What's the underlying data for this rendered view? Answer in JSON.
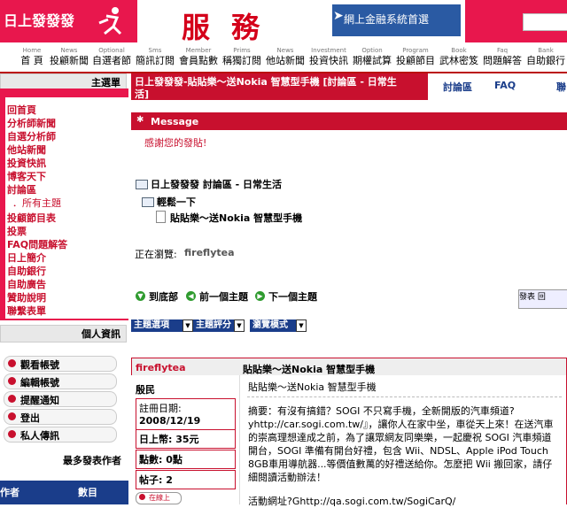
{
  "header": {
    "logo_text": "日上發發發",
    "service_text": "服務",
    "finance_link": "網上金融系統首選"
  },
  "nav": [
    {
      "en": "Home",
      "zh": "首 頁"
    },
    {
      "en": "News",
      "zh": "投顧新聞"
    },
    {
      "en": "Optional",
      "zh": "自選者節"
    },
    {
      "en": "Sms",
      "zh": "簡訊訂閱"
    },
    {
      "en": "Member",
      "zh": "會員點數"
    },
    {
      "en": "Prims",
      "zh": "稱獨訂閱"
    },
    {
      "en": "News",
      "zh": "他站新聞"
    },
    {
      "en": "Investment",
      "zh": "投資快訊"
    },
    {
      "en": "Option",
      "zh": "期權試算"
    },
    {
      "en": "Program",
      "zh": "投顧節目"
    },
    {
      "en": "Book",
      "zh": "武林密笈"
    },
    {
      "en": "Faq",
      "zh": "問題解答"
    },
    {
      "en": "Bank",
      "zh": "自助銀行"
    }
  ],
  "sidebar": {
    "main_menu_title": "主選單",
    "menu_items": [
      "回首頁",
      "分析師新聞",
      "自選分析師",
      "他站新聞",
      "投資快訊",
      "博客天下",
      "討論區",
      "．所有主題",
      "投顧節目表",
      "投票",
      "FAQ問題解答",
      "日上簡介",
      "自助銀行",
      "自助廣告",
      "贊助說明",
      "聯繫表單"
    ],
    "user_info_title": "個人資訊",
    "user_buttons": [
      "觀看帳號",
      "編輯帳號",
      "提醒通知",
      "登出",
      "私人傳訊"
    ],
    "top_posters_title": "最多發表作者",
    "table_headers": [
      "作者",
      "數目"
    ]
  },
  "main": {
    "topic_title": "日上發發發-貼貼樂～送Nokia 智慧型手機 [討論區 - 日常生活]",
    "toolbar": [
      "討論區",
      "FAQ",
      "聯"
    ],
    "message_title": "Message",
    "thanks_text": "感謝您的發貼!",
    "breadcrumb_forum": "日上發發發 討論區 - 日常生活",
    "breadcrumb_relax": "輕鬆一下",
    "breadcrumb_topic": "貼貼樂～送Nokia 智慧型手機",
    "viewing_label": "正在瀏覽:",
    "viewing_user": "fireflytea",
    "nav_bottom": "到底部",
    "nav_prev": "前一個主題",
    "nav_next": "下一個主題",
    "reply_label": "發表 回",
    "select_topic_options": "主題選項",
    "select_topic_rating": "主題評分",
    "select_view_mode": "瀏覽模式",
    "post": {
      "author": "fireflytea",
      "subject": "貼貼樂～送Nokia 智慧型手機",
      "rank": "殷民",
      "reg_label": "註冊日期:",
      "reg_date": "2008/12/19",
      "coins": "日上幣:  35元",
      "points": "點數: 0點",
      "posts": "帖子: 2",
      "online": "在線上",
      "body_title": "貼貼樂～送Nokia 智慧型手機",
      "body_text": "摘要：有沒有搞錯？SOGI 不只寫手機，全新開版的汽車頻道?yhttp://car.sogi.com.tw/』，讓你人在家中坐，車從天上來！在送汽車的崇高理想達成之前，為了讓眾網友同樂樂，一起慶祝 SOGI 汽車頻道開台，SOGI 準備有開台好禮，包含 Wii、NDSL、Apple iPod Touch 8GB車用導航器...等價值數萬的好禮送給你。怎麼把 Wii 搬回家，請仔細閱讀活動辦法！",
      "event_link": "活動網址?Ghttp://qa.sogi.com.tw/SogiCarQ/"
    }
  }
}
